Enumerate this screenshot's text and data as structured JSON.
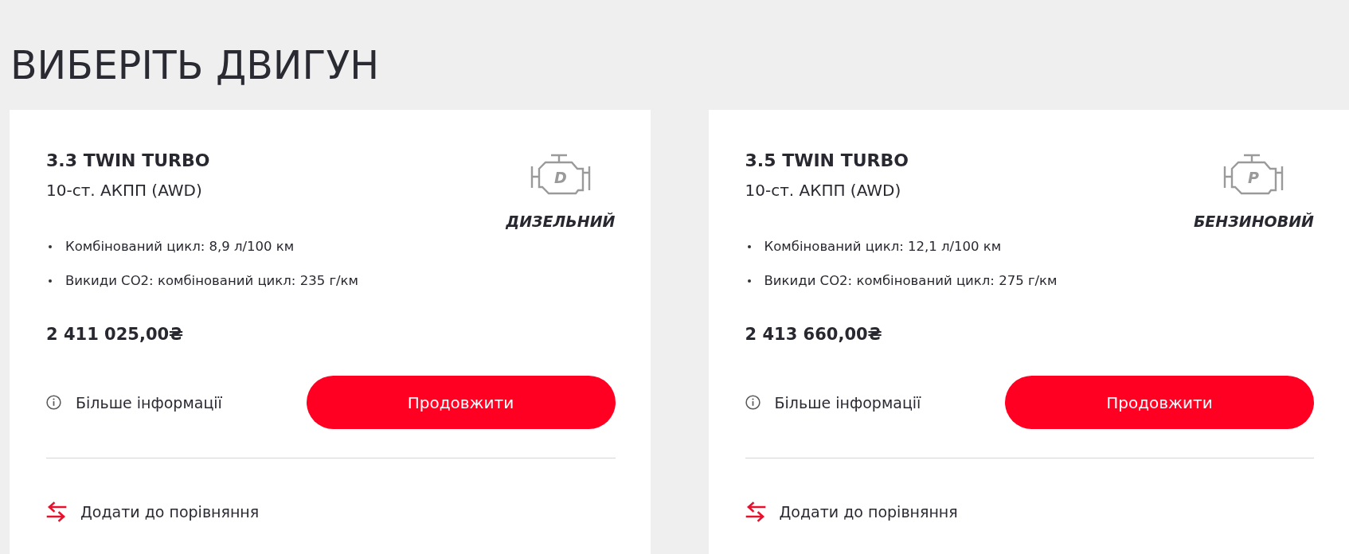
{
  "page_title": "ВИБЕРІТЬ ДВИГУН",
  "engines": [
    {
      "name": "3.3 TWIN TURBO",
      "transmission": "10-ст. АКПП (AWD)",
      "fuel_letter": "D",
      "fuel_label": "ДИЗЕЛЬНИЙ",
      "specs": [
        "Комбінований цикл: 8,9 л/100 км",
        "Викиди CO2: комбінований цикл: 235 г/км"
      ],
      "price": "2 411 025,00₴",
      "info_link": "Більше інформації",
      "continue_button": "Продовжити",
      "compare_link": "Додати до порівняння"
    },
    {
      "name": "3.5 TWIN TURBO",
      "transmission": "10-ст. АКПП (AWD)",
      "fuel_letter": "P",
      "fuel_label": "БЕНЗИНОВИЙ",
      "specs": [
        "Комбінований цикл: 12,1 л/100 км",
        "Викиди CO2: комбінований цикл: 275 г/км"
      ],
      "price": "2 413 660,00₴",
      "info_link": "Більше інформації",
      "continue_button": "Продовжити",
      "compare_link": "Додати до порівняння"
    }
  ]
}
